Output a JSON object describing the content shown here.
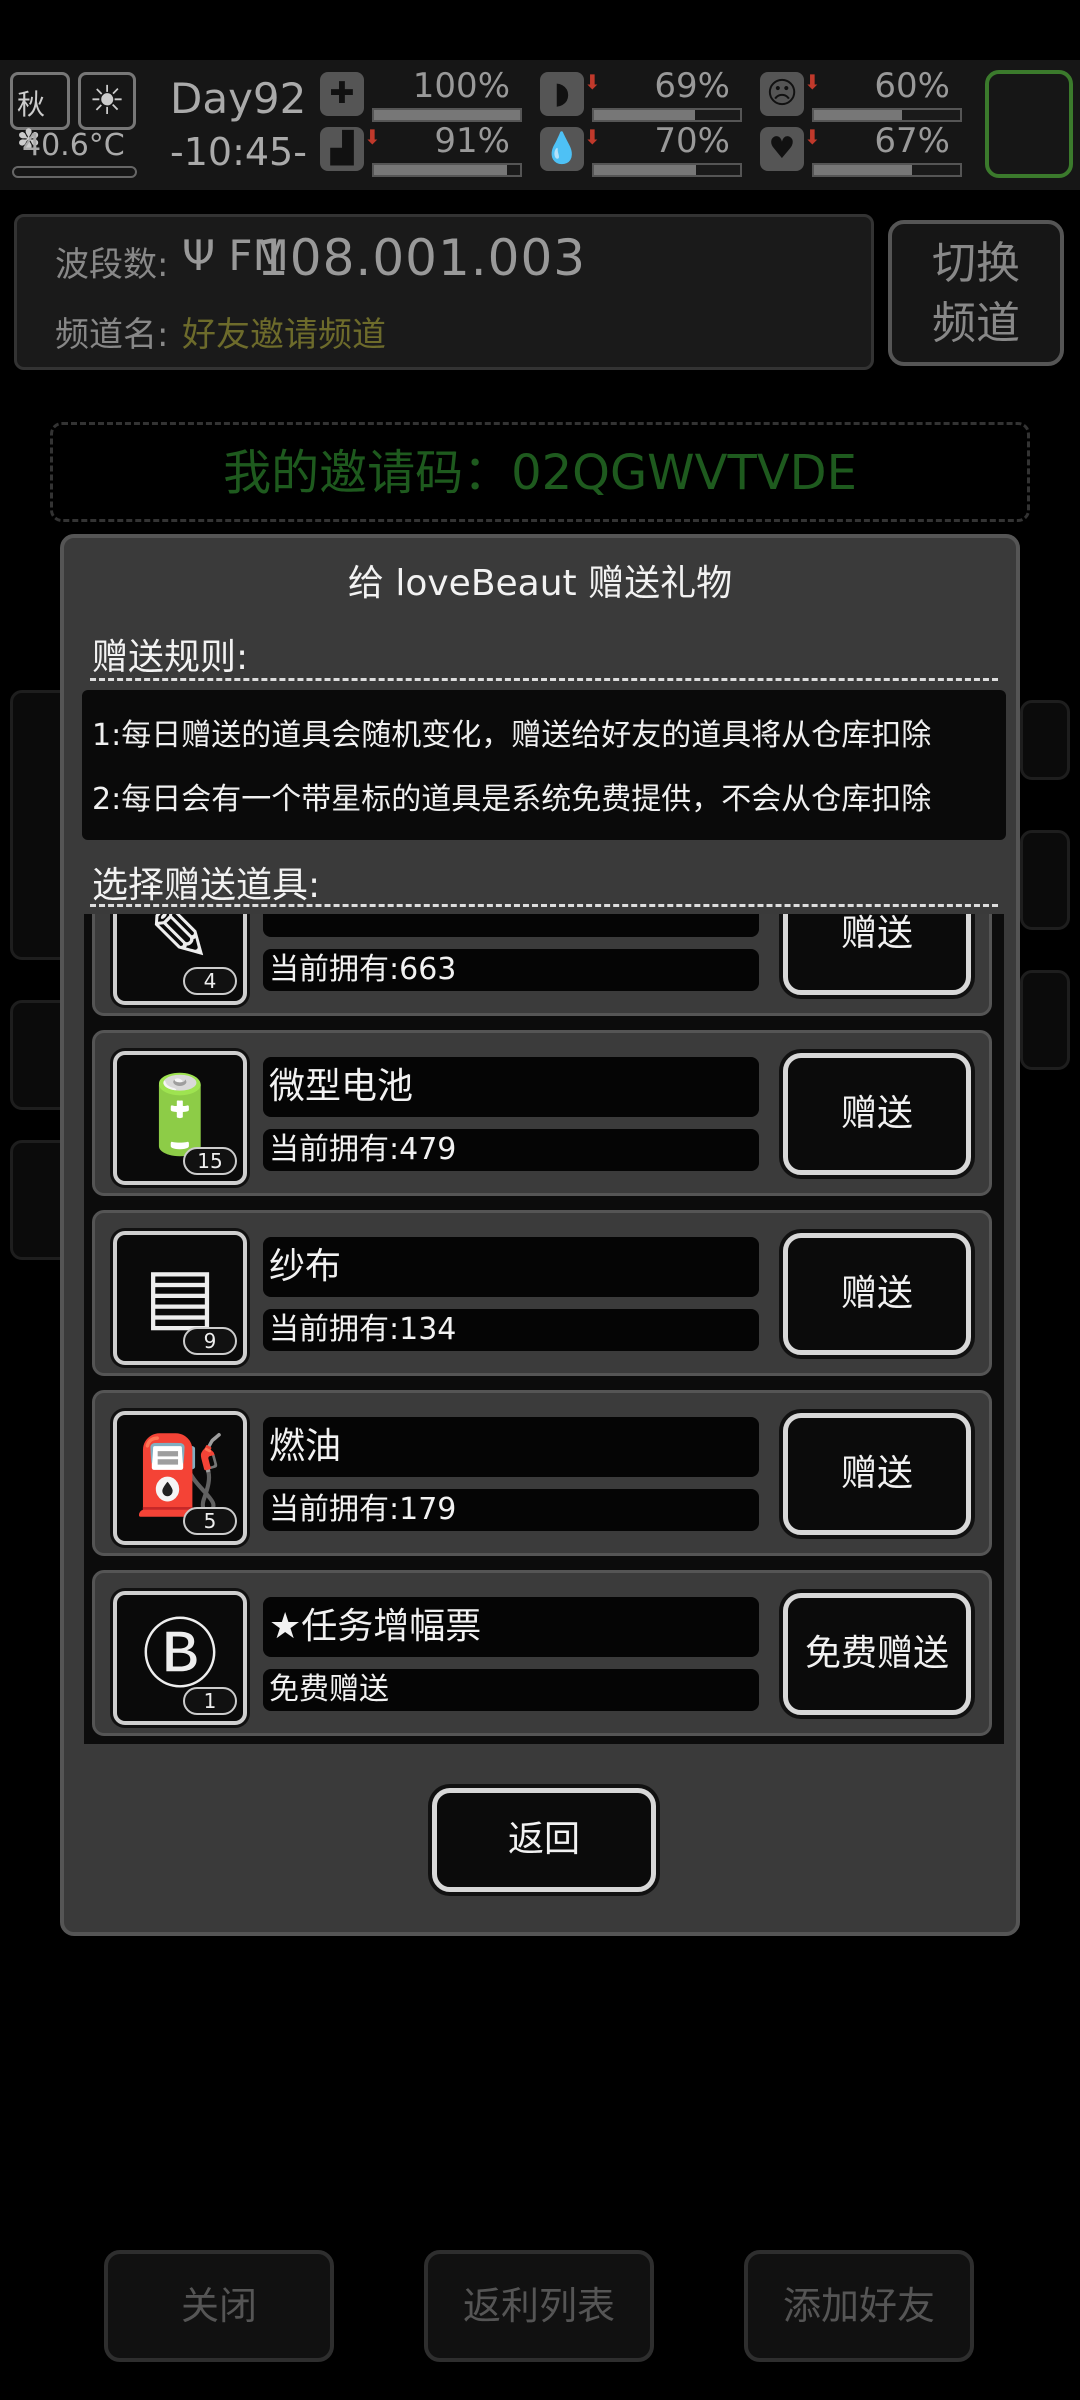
{
  "status": {
    "season": "秋",
    "temperature": "40.6°C",
    "day": "Day92",
    "time": "-10:45-",
    "stats": [
      {
        "icon": "medkit-icon",
        "glyph": "✚",
        "value": "100%",
        "level": 1.0,
        "decreasing": false
      },
      {
        "icon": "stomach-icon",
        "glyph": "◗",
        "value": "69%",
        "level": 0.69,
        "decreasing": true
      },
      {
        "icon": "mood-icon",
        "glyph": "☹",
        "value": "60%",
        "level": 0.6,
        "decreasing": true
      },
      {
        "icon": "leg-icon",
        "glyph": "▟",
        "value": "91%",
        "level": 0.91,
        "decreasing": true
      },
      {
        "icon": "water-drop-icon",
        "glyph": "💧",
        "value": "70%",
        "level": 0.7,
        "decreasing": true
      },
      {
        "icon": "heart-icon",
        "glyph": "♥",
        "value": "67%",
        "level": 0.67,
        "decreasing": true
      }
    ]
  },
  "radio": {
    "band_label": "波段数:",
    "antenna": "Ψ FM",
    "frequency": "108.001.003",
    "channel_label": "频道名:",
    "channel_name": "好友邀请频道",
    "switch_label": "切换频道"
  },
  "invite_code": "我的邀请码：02QGWVTVDE",
  "modal": {
    "title": "给 loveBeaut 赠送礼物",
    "rules_heading": "赠送规则:",
    "rules": [
      "1:每日赠送的道具会随机变化，赠送给好友的道具将从仓库扣除",
      "2:每日会有一个带星标的道具是系统免费提供，不会从仓库扣除"
    ],
    "choose_heading": "选择赠送道具:",
    "items": [
      {
        "name": "",
        "owned": "当前拥有:663",
        "count": "4",
        "icon": "pencil-icon",
        "glyph": "✎",
        "button": "赠送"
      },
      {
        "name": "微型电池",
        "owned": "当前拥有:479",
        "count": "15",
        "icon": "battery-icon",
        "glyph": "🔋",
        "button": "赠送"
      },
      {
        "name": "纱布",
        "owned": "当前拥有:134",
        "count": "9",
        "icon": "gauze-icon",
        "glyph": "▤",
        "button": "赠送"
      },
      {
        "name": "燃油",
        "owned": "当前拥有:179",
        "count": "5",
        "icon": "fuel-barrel-icon",
        "glyph": "⛽",
        "button": "赠送"
      },
      {
        "name": "★任务增幅票",
        "owned": "免费赠送",
        "count": "1",
        "icon": "ticket-icon",
        "glyph": "Ⓑ",
        "button": "免费赠送"
      }
    ],
    "back_label": "返回"
  },
  "bottom": {
    "close": "关闭",
    "rebate_list": "返利列表",
    "add_friend": "添加好友"
  }
}
